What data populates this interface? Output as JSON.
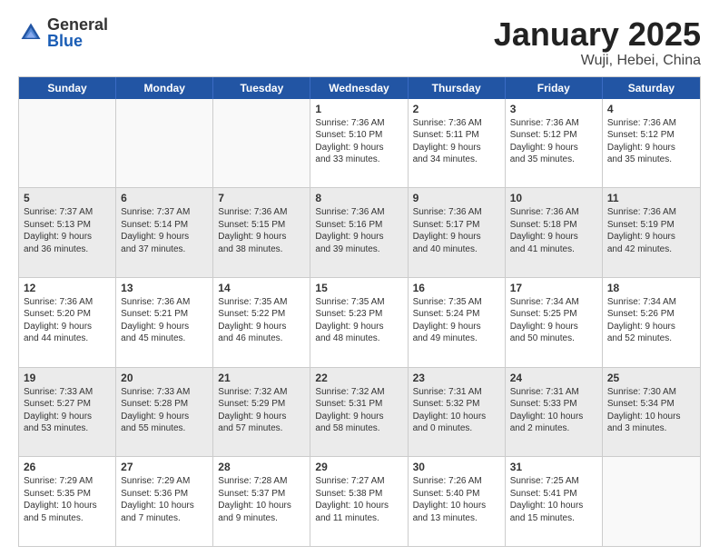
{
  "logo": {
    "general": "General",
    "blue": "Blue"
  },
  "title": {
    "month": "January 2025",
    "location": "Wuji, Hebei, China"
  },
  "header_days": [
    "Sunday",
    "Monday",
    "Tuesday",
    "Wednesday",
    "Thursday",
    "Friday",
    "Saturday"
  ],
  "weeks": [
    [
      {
        "date": "",
        "info": ""
      },
      {
        "date": "",
        "info": ""
      },
      {
        "date": "",
        "info": ""
      },
      {
        "date": "1",
        "info": "Sunrise: 7:36 AM\nSunset: 5:10 PM\nDaylight: 9 hours\nand 33 minutes."
      },
      {
        "date": "2",
        "info": "Sunrise: 7:36 AM\nSunset: 5:11 PM\nDaylight: 9 hours\nand 34 minutes."
      },
      {
        "date": "3",
        "info": "Sunrise: 7:36 AM\nSunset: 5:12 PM\nDaylight: 9 hours\nand 35 minutes."
      },
      {
        "date": "4",
        "info": "Sunrise: 7:36 AM\nSunset: 5:12 PM\nDaylight: 9 hours\nand 35 minutes."
      }
    ],
    [
      {
        "date": "5",
        "info": "Sunrise: 7:37 AM\nSunset: 5:13 PM\nDaylight: 9 hours\nand 36 minutes."
      },
      {
        "date": "6",
        "info": "Sunrise: 7:37 AM\nSunset: 5:14 PM\nDaylight: 9 hours\nand 37 minutes."
      },
      {
        "date": "7",
        "info": "Sunrise: 7:36 AM\nSunset: 5:15 PM\nDaylight: 9 hours\nand 38 minutes."
      },
      {
        "date": "8",
        "info": "Sunrise: 7:36 AM\nSunset: 5:16 PM\nDaylight: 9 hours\nand 39 minutes."
      },
      {
        "date": "9",
        "info": "Sunrise: 7:36 AM\nSunset: 5:17 PM\nDaylight: 9 hours\nand 40 minutes."
      },
      {
        "date": "10",
        "info": "Sunrise: 7:36 AM\nSunset: 5:18 PM\nDaylight: 9 hours\nand 41 minutes."
      },
      {
        "date": "11",
        "info": "Sunrise: 7:36 AM\nSunset: 5:19 PM\nDaylight: 9 hours\nand 42 minutes."
      }
    ],
    [
      {
        "date": "12",
        "info": "Sunrise: 7:36 AM\nSunset: 5:20 PM\nDaylight: 9 hours\nand 44 minutes."
      },
      {
        "date": "13",
        "info": "Sunrise: 7:36 AM\nSunset: 5:21 PM\nDaylight: 9 hours\nand 45 minutes."
      },
      {
        "date": "14",
        "info": "Sunrise: 7:35 AM\nSunset: 5:22 PM\nDaylight: 9 hours\nand 46 minutes."
      },
      {
        "date": "15",
        "info": "Sunrise: 7:35 AM\nSunset: 5:23 PM\nDaylight: 9 hours\nand 48 minutes."
      },
      {
        "date": "16",
        "info": "Sunrise: 7:35 AM\nSunset: 5:24 PM\nDaylight: 9 hours\nand 49 minutes."
      },
      {
        "date": "17",
        "info": "Sunrise: 7:34 AM\nSunset: 5:25 PM\nDaylight: 9 hours\nand 50 minutes."
      },
      {
        "date": "18",
        "info": "Sunrise: 7:34 AM\nSunset: 5:26 PM\nDaylight: 9 hours\nand 52 minutes."
      }
    ],
    [
      {
        "date": "19",
        "info": "Sunrise: 7:33 AM\nSunset: 5:27 PM\nDaylight: 9 hours\nand 53 minutes."
      },
      {
        "date": "20",
        "info": "Sunrise: 7:33 AM\nSunset: 5:28 PM\nDaylight: 9 hours\nand 55 minutes."
      },
      {
        "date": "21",
        "info": "Sunrise: 7:32 AM\nSunset: 5:29 PM\nDaylight: 9 hours\nand 57 minutes."
      },
      {
        "date": "22",
        "info": "Sunrise: 7:32 AM\nSunset: 5:31 PM\nDaylight: 9 hours\nand 58 minutes."
      },
      {
        "date": "23",
        "info": "Sunrise: 7:31 AM\nSunset: 5:32 PM\nDaylight: 10 hours\nand 0 minutes."
      },
      {
        "date": "24",
        "info": "Sunrise: 7:31 AM\nSunset: 5:33 PM\nDaylight: 10 hours\nand 2 minutes."
      },
      {
        "date": "25",
        "info": "Sunrise: 7:30 AM\nSunset: 5:34 PM\nDaylight: 10 hours\nand 3 minutes."
      }
    ],
    [
      {
        "date": "26",
        "info": "Sunrise: 7:29 AM\nSunset: 5:35 PM\nDaylight: 10 hours\nand 5 minutes."
      },
      {
        "date": "27",
        "info": "Sunrise: 7:29 AM\nSunset: 5:36 PM\nDaylight: 10 hours\nand 7 minutes."
      },
      {
        "date": "28",
        "info": "Sunrise: 7:28 AM\nSunset: 5:37 PM\nDaylight: 10 hours\nand 9 minutes."
      },
      {
        "date": "29",
        "info": "Sunrise: 7:27 AM\nSunset: 5:38 PM\nDaylight: 10 hours\nand 11 minutes."
      },
      {
        "date": "30",
        "info": "Sunrise: 7:26 AM\nSunset: 5:40 PM\nDaylight: 10 hours\nand 13 minutes."
      },
      {
        "date": "31",
        "info": "Sunrise: 7:25 AM\nSunset: 5:41 PM\nDaylight: 10 hours\nand 15 minutes."
      },
      {
        "date": "",
        "info": ""
      }
    ]
  ]
}
